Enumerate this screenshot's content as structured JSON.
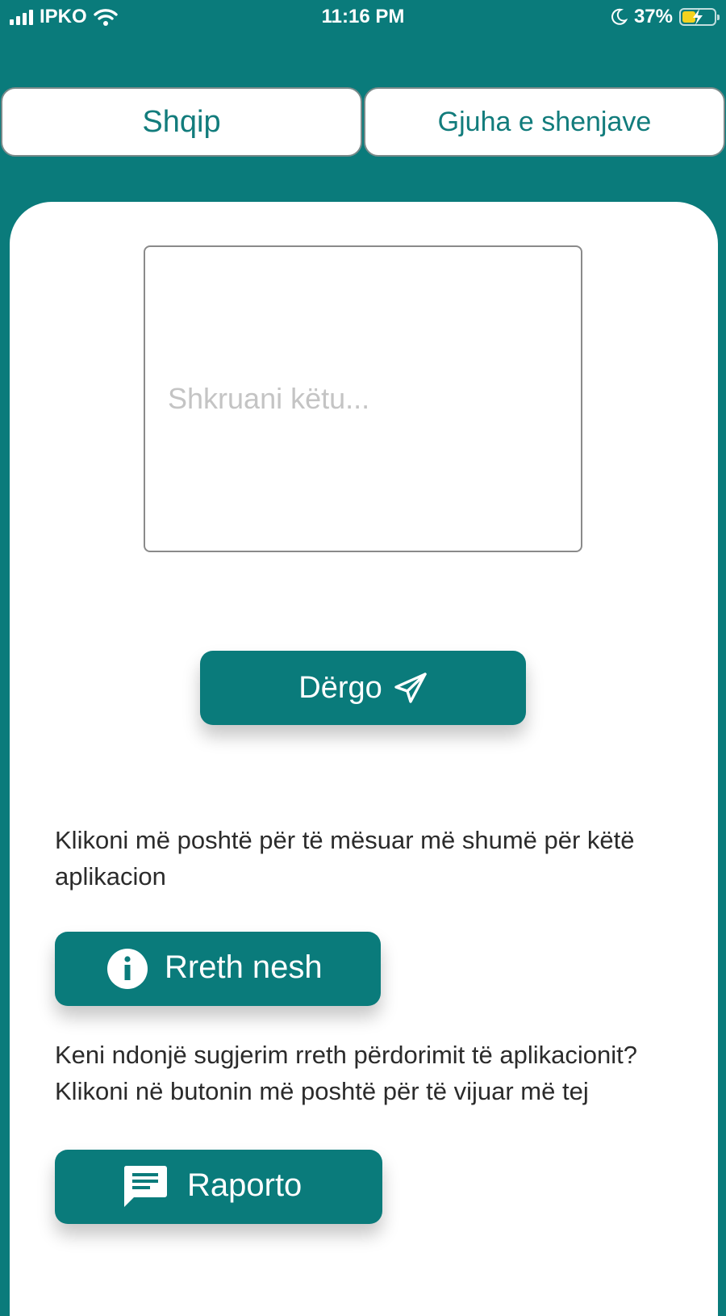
{
  "status_bar": {
    "carrier": "IPKO",
    "time": "11:16 PM",
    "battery_percent": "37%",
    "battery_level": 0.37,
    "icons": [
      "signal-icon",
      "wifi-icon",
      "moon-icon",
      "battery-icon"
    ]
  },
  "tabs": [
    {
      "label": "Shqip"
    },
    {
      "label": "Gjuha e shenjave"
    }
  ],
  "input": {
    "placeholder": "Shkruani këtu...",
    "value": ""
  },
  "send_button": {
    "label": "Dërgo",
    "icon": "send-icon"
  },
  "about": {
    "text": "Klikoni më poshtë për të mësuar më shumë për këtë aplikacion",
    "button_label": "Rreth nesh",
    "icon": "info-icon"
  },
  "report": {
    "text": "Keni ndonjë sugjerim rreth përdorimit të aplikacionit? Klikoni në butonin më poshtë për të vijuar më tej",
    "button_label": "Raporto",
    "icon": "message-icon"
  },
  "colors": {
    "accent": "#0a7b7b",
    "card_background": "#ffffff",
    "body_text": "#2b2b2b",
    "placeholder": "#c4c4c4"
  }
}
